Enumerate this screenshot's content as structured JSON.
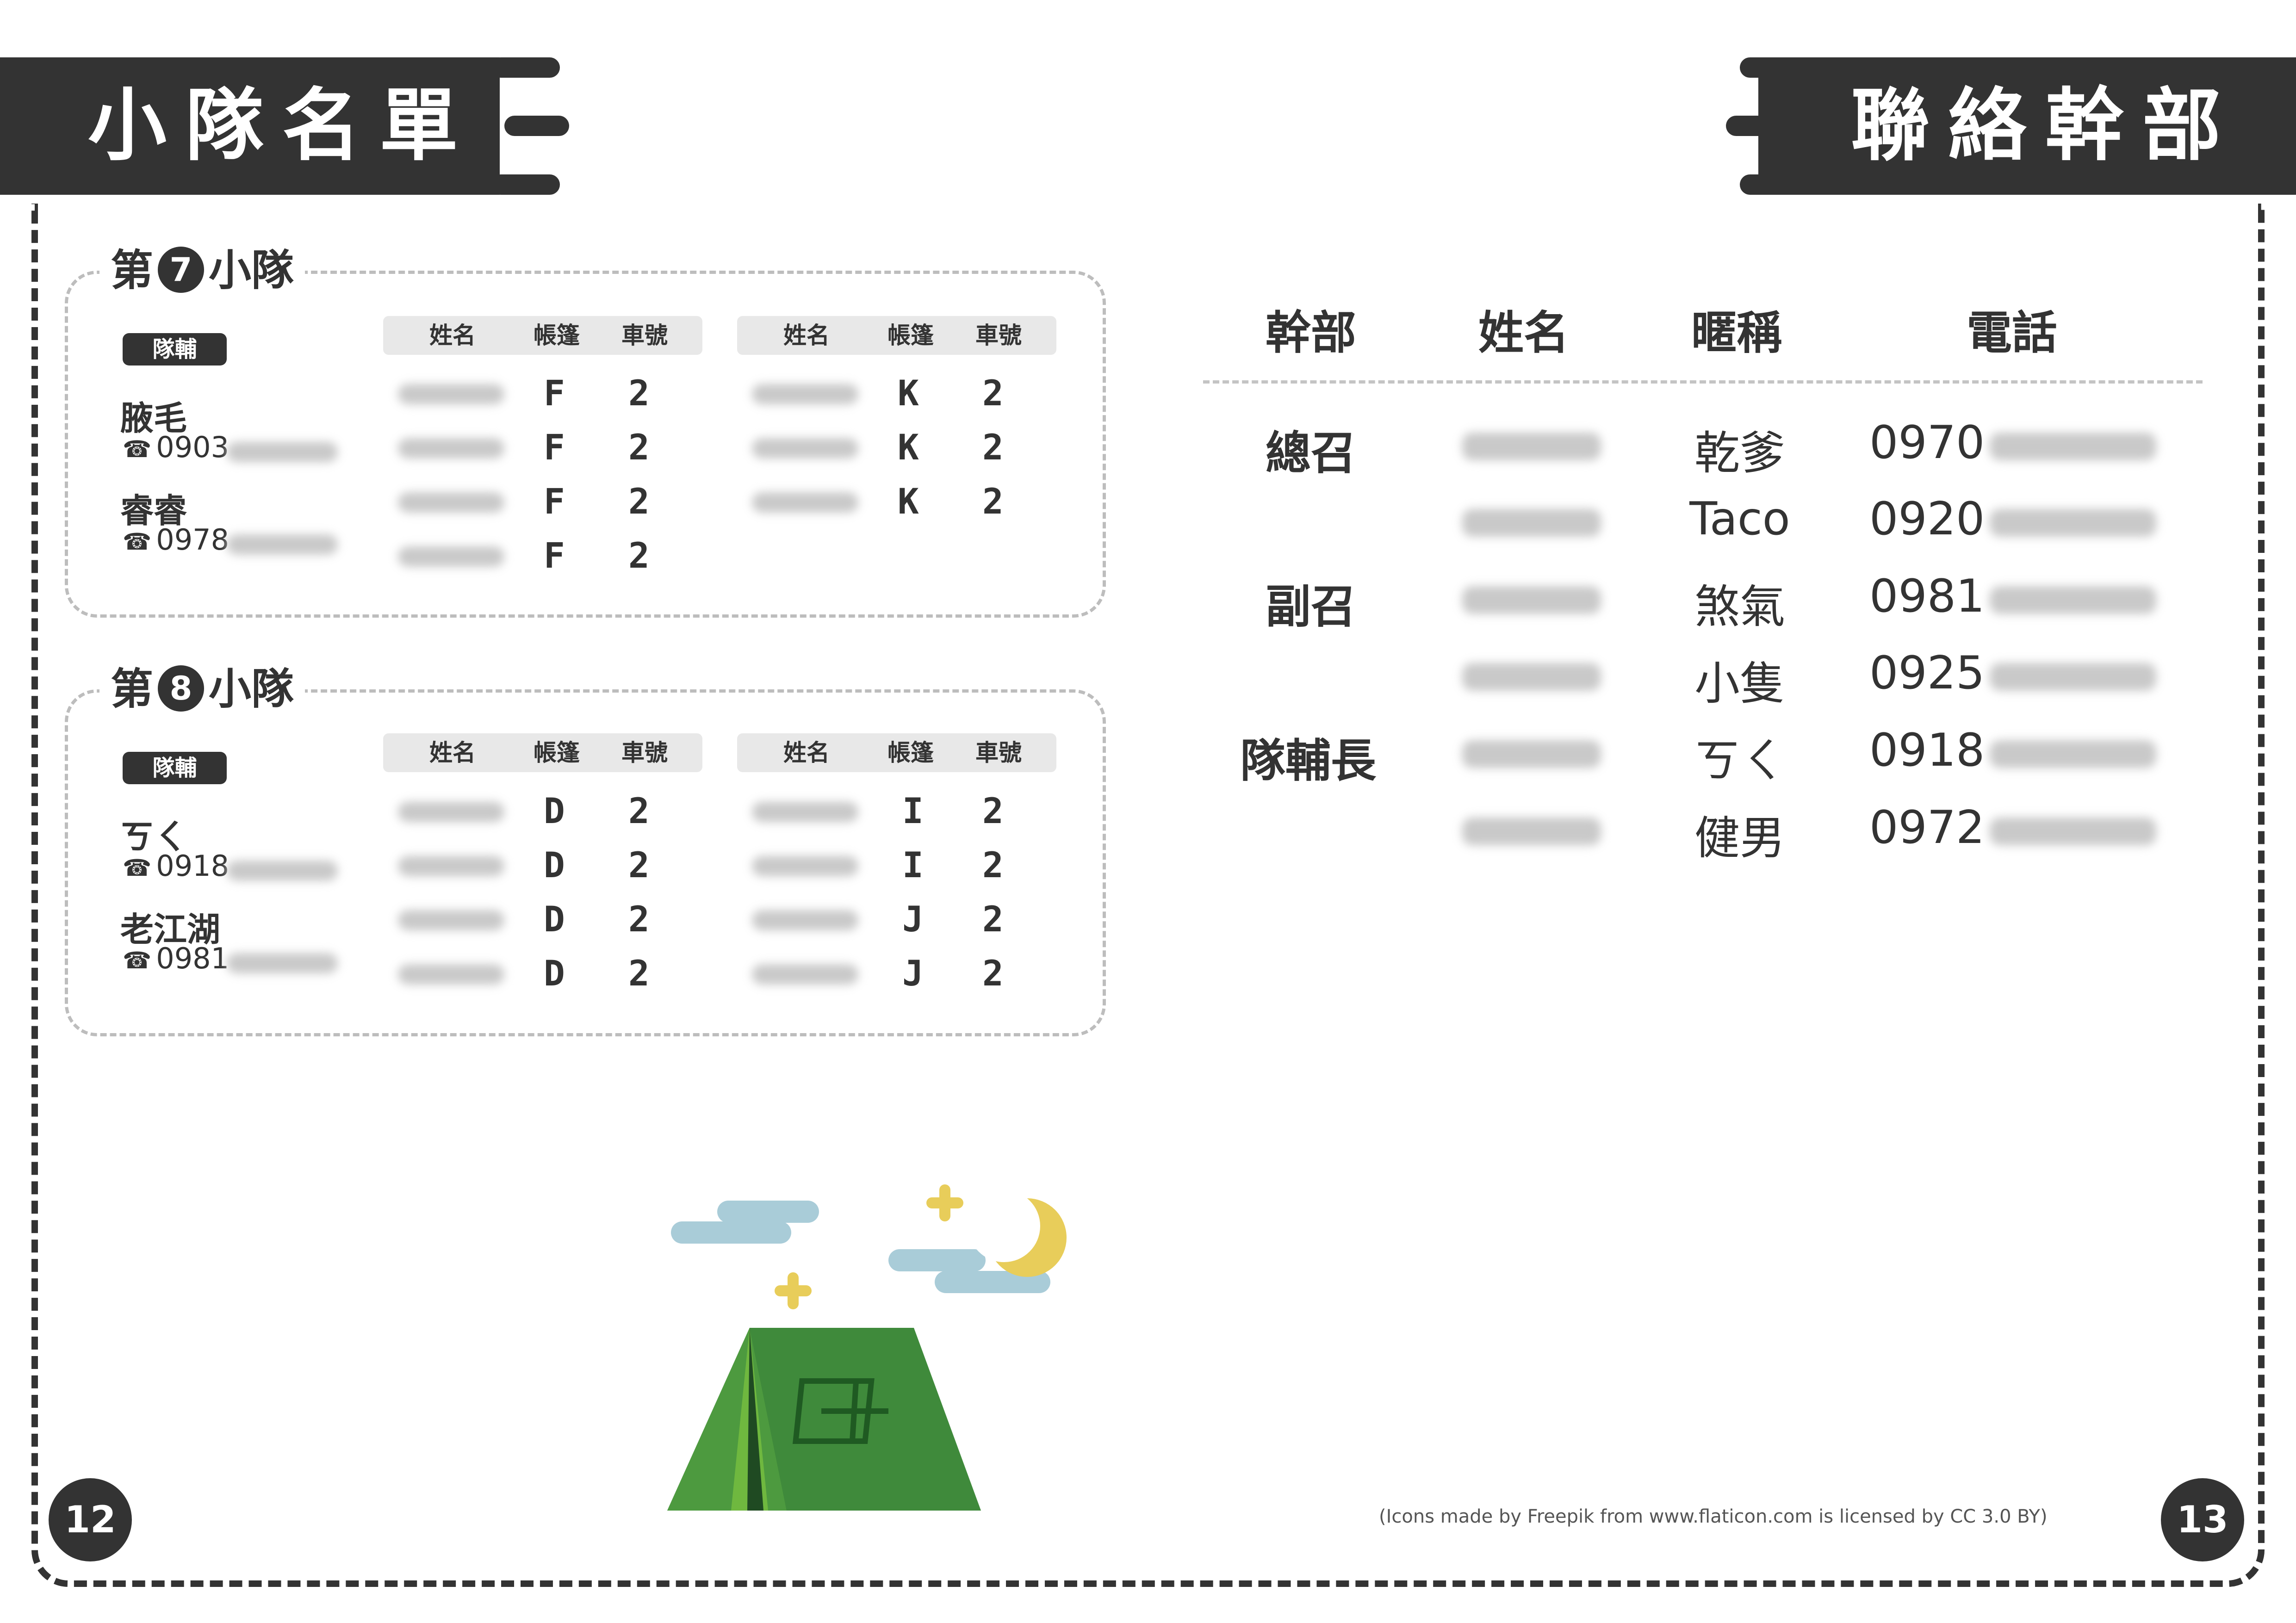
{
  "left_page": {
    "title": "小隊名單",
    "page_number": "12",
    "squads": [
      {
        "prefix": "第",
        "number": "7",
        "suffix": "小隊",
        "leaders_tag": "隊輔",
        "leaders": [
          {
            "name": "腋毛",
            "phone_prefix": "0903"
          },
          {
            "name": "睿睿",
            "phone_prefix": "0978"
          }
        ],
        "table_headers": [
          "姓名",
          "帳篷",
          "車號"
        ],
        "left_rows": [
          {
            "tent": "F",
            "car": "2"
          },
          {
            "tent": "F",
            "car": "2"
          },
          {
            "tent": "F",
            "car": "2"
          },
          {
            "tent": "F",
            "car": "2"
          }
        ],
        "right_rows": [
          {
            "tent": "K",
            "car": "2"
          },
          {
            "tent": "K",
            "car": "2"
          },
          {
            "tent": "K",
            "car": "2"
          }
        ]
      },
      {
        "prefix": "第",
        "number": "8",
        "suffix": "小隊",
        "leaders_tag": "隊輔",
        "leaders": [
          {
            "name": "ㄎㄑ",
            "phone_prefix": "0918"
          },
          {
            "name": "老江湖",
            "phone_prefix": "0981"
          }
        ],
        "table_headers": [
          "姓名",
          "帳篷",
          "車號"
        ],
        "left_rows": [
          {
            "tent": "D",
            "car": "2"
          },
          {
            "tent": "D",
            "car": "2"
          },
          {
            "tent": "D",
            "car": "2"
          },
          {
            "tent": "D",
            "car": "2"
          }
        ],
        "right_rows": [
          {
            "tent": "I",
            "car": "2"
          },
          {
            "tent": "I",
            "car": "2"
          },
          {
            "tent": "J",
            "car": "2"
          },
          {
            "tent": "J",
            "car": "2"
          }
        ]
      }
    ],
    "illustration": {
      "icons": [
        "tent-icon",
        "moon-icon",
        "cloud-icon",
        "sparkle-icon"
      ],
      "colors": {
        "tent_dark": "#2e6b2f",
        "tent_mid": "#3f8a3b",
        "tent_light": "#6fb83f",
        "moon": "#e8cd5a",
        "cloud": "#a9ccd8"
      }
    }
  },
  "right_page": {
    "title": "聯絡幹部",
    "page_number": "13",
    "headers": {
      "role": "幹部",
      "name": "姓名",
      "nickname": "暱稱",
      "phone": "電話"
    },
    "rows": [
      {
        "role": "總召",
        "nickname": "乾爹",
        "phone_prefix": "0970"
      },
      {
        "role": "",
        "nickname": "Taco",
        "phone_prefix": "0920"
      },
      {
        "role": "副召",
        "nickname": "煞氣",
        "phone_prefix": "0981"
      },
      {
        "role": "",
        "nickname": "小隻",
        "phone_prefix": "0925"
      },
      {
        "role": "隊輔長",
        "nickname": "ㄎㄑ",
        "phone_prefix": "0918"
      },
      {
        "role": "",
        "nickname": "健男",
        "phone_prefix": "0972"
      }
    ],
    "credit": "(Icons made by Freepik from www.flaticon.com is licensed by CC 3.0 BY)"
  },
  "colors": {
    "dark": "#333333",
    "table_header_bg": "#e8e8e8",
    "dashed": "#bdbdbd"
  }
}
